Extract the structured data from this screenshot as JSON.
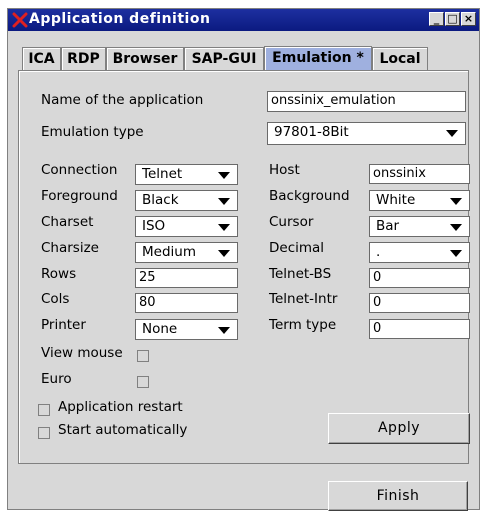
{
  "window": {
    "title": "Application definition",
    "minimize": "_",
    "maximize": "□",
    "close": "×"
  },
  "tabs": [
    {
      "label": "ICA"
    },
    {
      "label": "RDP"
    },
    {
      "label": "Browser"
    },
    {
      "label": "SAP-GUI"
    },
    {
      "label": "Emulation *"
    },
    {
      "label": "Local"
    }
  ],
  "form": {
    "name_label": "Name of the application",
    "name_value": "onssinix_emulation",
    "emutype_label": "Emulation type",
    "emutype_value": "97801-8Bit",
    "connection_label": "Connection",
    "connection_value": "Telnet",
    "foreground_label": "Foreground",
    "foreground_value": "Black",
    "charset_label": "Charset",
    "charset_value": "ISO",
    "charsize_label": "Charsize",
    "charsize_value": "Medium",
    "rows_label": "Rows",
    "rows_value": "25",
    "cols_label": "Cols",
    "cols_value": "80",
    "printer_label": "Printer",
    "printer_value": "None",
    "viewmouse_label": "View mouse",
    "euro_label": "Euro",
    "host_label": "Host",
    "host_value": "onssinix",
    "background_label": "Background",
    "background_value": "White",
    "cursor_label": "Cursor",
    "cursor_value": "Bar",
    "decimal_label": "Decimal",
    "decimal_value": ".",
    "telnetbs_label": "Telnet-BS",
    "telnetbs_value": "0",
    "telnetintr_label": "Telnet-Intr",
    "telnetintr_value": "0",
    "termtype_label": "Term type",
    "termtype_value": "0",
    "restart_label": "Application restart",
    "autostart_label": "Start automatically",
    "apply_label": "Apply"
  },
  "footer": {
    "finish_label": "Finish"
  },
  "colors": {
    "titlebar": "#0b1a80",
    "active_tab": "#9fb0df",
    "window_bg": "#d8d8d8"
  }
}
